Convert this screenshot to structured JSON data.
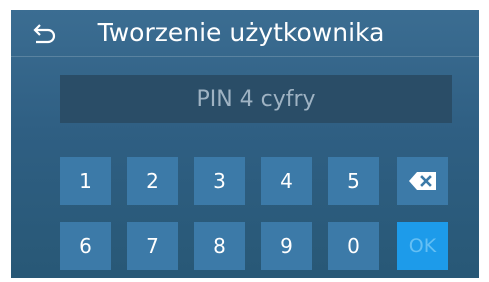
{
  "header": {
    "back_icon": "back-arrow-icon",
    "title": "Tworzenie użytkownika"
  },
  "pin_field": {
    "placeholder": "PIN 4 cyfry",
    "value": ""
  },
  "keypad": {
    "row1": [
      "1",
      "2",
      "3",
      "4",
      "5"
    ],
    "row2": [
      "6",
      "7",
      "8",
      "9",
      "0"
    ],
    "backspace_icon": "backspace-icon",
    "ok_label": "OK"
  },
  "colors": {
    "background": "#2f5f83",
    "key": "#3c7aa8",
    "ok_key": "#1d9bea",
    "field": "#2a4d67"
  }
}
